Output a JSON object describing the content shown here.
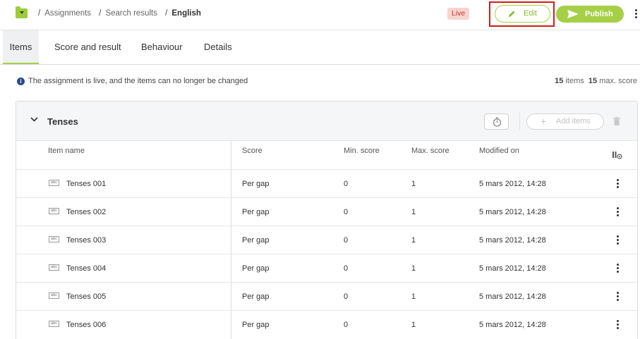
{
  "breadcrumb": {
    "items": [
      "Assignments",
      "Search results"
    ],
    "current": "English"
  },
  "header": {
    "status_badge": "Live",
    "edit_label": "Edit",
    "publish_label": "Publish"
  },
  "tabs": [
    {
      "label": "Items",
      "active": true
    },
    {
      "label": "Score and result",
      "active": false
    },
    {
      "label": "Behaviour",
      "active": false
    },
    {
      "label": "Details",
      "active": false
    }
  ],
  "info": {
    "message": "The assignment is live, and the items can no longer be changed",
    "items_count": "15",
    "items_label": "items",
    "max_score_count": "15",
    "max_score_label": "max. score"
  },
  "section": {
    "title": "Tenses",
    "add_items_label": "Add items"
  },
  "table": {
    "columns": [
      "Item name",
      "Score",
      "Min. score",
      "Max. score",
      "Modified on"
    ],
    "item_icon_text": "abc",
    "rows": [
      {
        "name": "Tenses 001",
        "score": "Per gap",
        "min": "0",
        "max": "1",
        "modified": "5 mars 2012, 14:28"
      },
      {
        "name": "Tenses 002",
        "score": "Per gap",
        "min": "0",
        "max": "1",
        "modified": "5 mars 2012, 14:28"
      },
      {
        "name": "Tenses 003",
        "score": "Per gap",
        "min": "0",
        "max": "1",
        "modified": "5 mars 2012, 14:28"
      },
      {
        "name": "Tenses 004",
        "score": "Per gap",
        "min": "0",
        "max": "1",
        "modified": "5 mars 2012, 14:28"
      },
      {
        "name": "Tenses 005",
        "score": "Per gap",
        "min": "0",
        "max": "1",
        "modified": "5 mars 2012, 14:28"
      },
      {
        "name": "Tenses 006",
        "score": "Per gap",
        "min": "0",
        "max": "1",
        "modified": "5 mars 2012, 14:28"
      }
    ]
  },
  "colors": {
    "accent": "#a6cf47",
    "live_badge_bg": "#f9d3cf",
    "live_badge_text": "#c0392b",
    "highlight_box": "#d11b1b",
    "info_icon": "#2c4a8a"
  }
}
